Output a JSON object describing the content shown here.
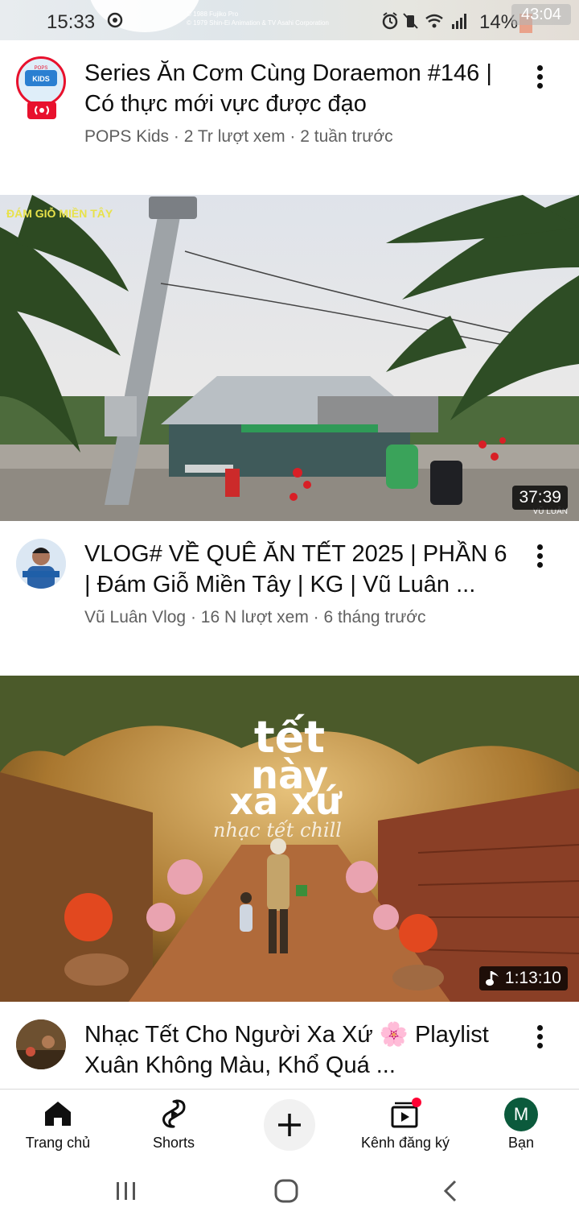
{
  "status_bar": {
    "time": "15:33",
    "battery": "14%",
    "overlay_time": "43:04",
    "copyright_lines": [
      "© 1988 Fujiko Pro",
      "© 1979 Shin-Ei Animation & TV Asahi Corporation"
    ]
  },
  "feed": [
    {
      "title": "Series Ăn Cơm Cùng Doraemon #146 | Có thực mới vực được đạo",
      "channel": "POPS Kids",
      "views": "2 Tr lượt xem",
      "age": "2 tuần trước",
      "avatar_text": "POPS KIDS",
      "live": true
    },
    {
      "title": "VLOG# VỀ QUÊ ĂN TẾT 2025 | PHẦN 6 | Đám Giỗ Miền Tây | KG | Vũ Luân ...",
      "channel": "Vũ Luân Vlog",
      "views": "16 N lượt xem",
      "age": "6 tháng trước",
      "duration": "37:39",
      "thumb_overlay_left": "ĐÁM GIỖ MIỀN TÂY",
      "thumb_overlay_right": "VŨ LUÂN"
    },
    {
      "title": "Nhạc Tết Cho Người Xa Xứ 🌸 Playlist Xuân Không Màu, Khổ Quá ...",
      "duration": "1:13:10",
      "thumb_text_1": "tết",
      "thumb_text_2": "này",
      "thumb_text_3": "xa xứ",
      "thumb_script": "nhạc tết chill"
    }
  ],
  "bottom_nav": [
    {
      "label": "Trang chủ",
      "icon": "home-icon"
    },
    {
      "label": "Shorts",
      "icon": "shorts-icon"
    },
    {
      "label": "",
      "icon": "create-plus-icon"
    },
    {
      "label": "Kênh đăng ký",
      "icon": "subscriptions-icon"
    },
    {
      "label": "Bạn",
      "icon": "account-avatar",
      "avatar_letter": "M"
    }
  ],
  "colors": {
    "accent_red": "#ff0033",
    "text_primary": "#0f0f0f",
    "text_secondary": "#606060",
    "avatar_green": "#0b5a3c"
  }
}
